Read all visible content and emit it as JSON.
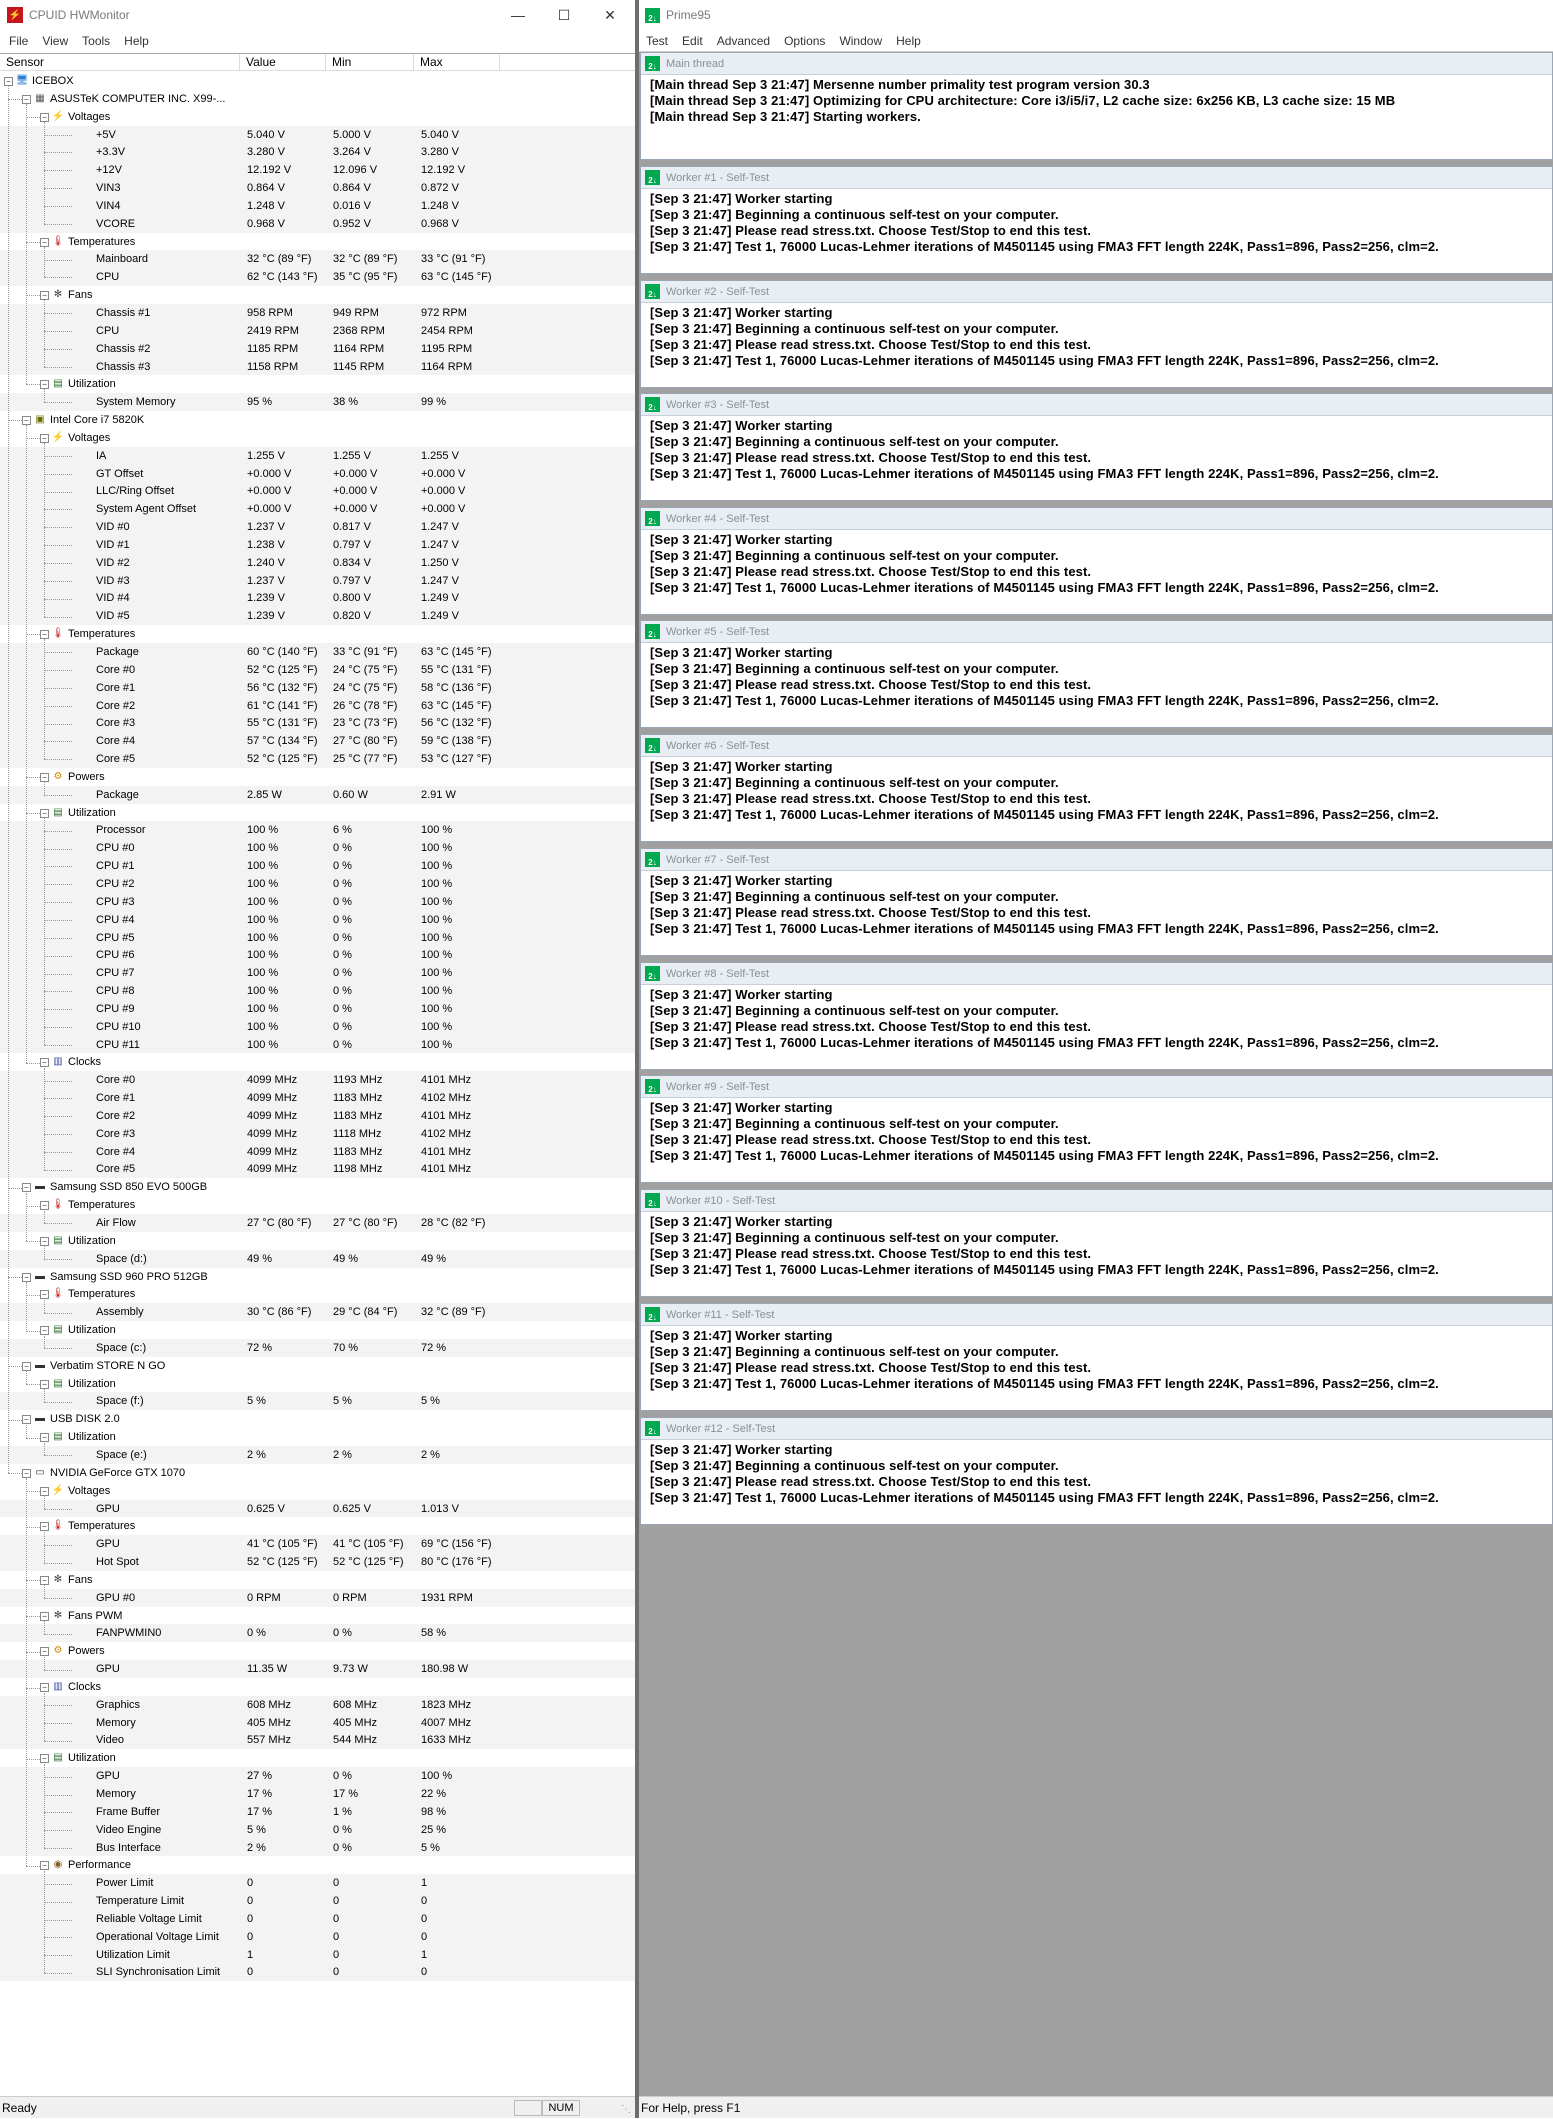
{
  "hwmonitor": {
    "title": "CPUID HWMonitor",
    "menu": [
      "File",
      "View",
      "Tools",
      "Help"
    ],
    "columns": [
      "Sensor",
      "Value",
      "Min",
      "Max"
    ],
    "status_text": "Ready",
    "status_num": "NUM",
    "rows": [
      {
        "level": 0,
        "icon": "computer",
        "label": "ICEBOX"
      },
      {
        "level": 1,
        "icon": "motherboard",
        "label": "ASUSTeK COMPUTER INC. X99-..."
      },
      {
        "level": 2,
        "icon": "voltage",
        "label": "Voltages"
      },
      {
        "level": 3,
        "label": "+5V",
        "v": "5.040 V",
        "mn": "5.000 V",
        "mx": "5.040 V"
      },
      {
        "level": 3,
        "label": "+3.3V",
        "v": "3.280 V",
        "mn": "3.264 V",
        "mx": "3.280 V"
      },
      {
        "level": 3,
        "label": "+12V",
        "v": "12.192 V",
        "mn": "12.096 V",
        "mx": "12.192 V"
      },
      {
        "level": 3,
        "label": "VIN3",
        "v": "0.864 V",
        "mn": "0.864 V",
        "mx": "0.872 V"
      },
      {
        "level": 3,
        "label": "VIN4",
        "v": "1.248 V",
        "mn": "0.016 V",
        "mx": "1.248 V"
      },
      {
        "level": 3,
        "label": "VCORE",
        "v": "0.968 V",
        "mn": "0.952 V",
        "mx": "0.968 V"
      },
      {
        "level": 2,
        "icon": "temperature",
        "label": "Temperatures"
      },
      {
        "level": 3,
        "label": "Mainboard",
        "v": "32 °C  (89 °F)",
        "mn": "32 °C  (89 °F)",
        "mx": "33 °C  (91 °F)"
      },
      {
        "level": 3,
        "label": "CPU",
        "v": "62 °C  (143 °F)",
        "mn": "35 °C  (95 °F)",
        "mx": "63 °C  (145 °F)"
      },
      {
        "level": 2,
        "icon": "fan",
        "label": "Fans"
      },
      {
        "level": 3,
        "label": "Chassis #1",
        "v": "958 RPM",
        "mn": "949 RPM",
        "mx": "972 RPM"
      },
      {
        "level": 3,
        "label": "CPU",
        "v": "2419 RPM",
        "mn": "2368 RPM",
        "mx": "2454 RPM"
      },
      {
        "level": 3,
        "label": "Chassis #2",
        "v": "1185 RPM",
        "mn": "1164 RPM",
        "mx": "1195 RPM"
      },
      {
        "level": 3,
        "label": "Chassis #3",
        "v": "1158 RPM",
        "mn": "1145 RPM",
        "mx": "1164 RPM"
      },
      {
        "level": 2,
        "icon": "utilization",
        "label": "Utilization"
      },
      {
        "level": 3,
        "label": "System Memory",
        "v": "95 %",
        "mn": "38 %",
        "mx": "99 %"
      },
      {
        "level": 1,
        "icon": "cpu",
        "label": "Intel Core i7 5820K"
      },
      {
        "level": 2,
        "icon": "voltage",
        "label": "Voltages"
      },
      {
        "level": 3,
        "label": "IA",
        "v": "1.255 V",
        "mn": "1.255 V",
        "mx": "1.255 V"
      },
      {
        "level": 3,
        "label": "GT Offset",
        "v": "+0.000 V",
        "mn": "+0.000 V",
        "mx": "+0.000 V"
      },
      {
        "level": 3,
        "label": "LLC/Ring Offset",
        "v": "+0.000 V",
        "mn": "+0.000 V",
        "mx": "+0.000 V"
      },
      {
        "level": 3,
        "label": "System Agent Offset",
        "v": "+0.000 V",
        "mn": "+0.000 V",
        "mx": "+0.000 V"
      },
      {
        "level": 3,
        "label": "VID #0",
        "v": "1.237 V",
        "mn": "0.817 V",
        "mx": "1.247 V"
      },
      {
        "level": 3,
        "label": "VID #1",
        "v": "1.238 V",
        "mn": "0.797 V",
        "mx": "1.247 V"
      },
      {
        "level": 3,
        "label": "VID #2",
        "v": "1.240 V",
        "mn": "0.834 V",
        "mx": "1.250 V"
      },
      {
        "level": 3,
        "label": "VID #3",
        "v": "1.237 V",
        "mn": "0.797 V",
        "mx": "1.247 V"
      },
      {
        "level": 3,
        "label": "VID #4",
        "v": "1.239 V",
        "mn": "0.800 V",
        "mx": "1.249 V"
      },
      {
        "level": 3,
        "label": "VID #5",
        "v": "1.239 V",
        "mn": "0.820 V",
        "mx": "1.249 V"
      },
      {
        "level": 2,
        "icon": "temperature",
        "label": "Temperatures"
      },
      {
        "level": 3,
        "label": "Package",
        "v": "60 °C  (140 °F)",
        "mn": "33 °C  (91 °F)",
        "mx": "63 °C  (145 °F)"
      },
      {
        "level": 3,
        "label": "Core #0",
        "v": "52 °C  (125 °F)",
        "mn": "24 °C  (75 °F)",
        "mx": "55 °C  (131 °F)"
      },
      {
        "level": 3,
        "label": "Core #1",
        "v": "56 °C  (132 °F)",
        "mn": "24 °C  (75 °F)",
        "mx": "58 °C  (136 °F)"
      },
      {
        "level": 3,
        "label": "Core #2",
        "v": "61 °C  (141 °F)",
        "mn": "26 °C  (78 °F)",
        "mx": "63 °C  (145 °F)"
      },
      {
        "level": 3,
        "label": "Core #3",
        "v": "55 °C  (131 °F)",
        "mn": "23 °C  (73 °F)",
        "mx": "56 °C  (132 °F)"
      },
      {
        "level": 3,
        "label": "Core #4",
        "v": "57 °C  (134 °F)",
        "mn": "27 °C  (80 °F)",
        "mx": "59 °C  (138 °F)"
      },
      {
        "level": 3,
        "label": "Core #5",
        "v": "52 °C  (125 °F)",
        "mn": "25 °C  (77 °F)",
        "mx": "53 °C  (127 °F)"
      },
      {
        "level": 2,
        "icon": "power",
        "label": "Powers"
      },
      {
        "level": 3,
        "label": "Package",
        "v": "2.85 W",
        "mn": "0.60 W",
        "mx": "2.91 W"
      },
      {
        "level": 2,
        "icon": "utilization",
        "label": "Utilization"
      },
      {
        "level": 3,
        "label": "Processor",
        "v": "100 %",
        "mn": "6 %",
        "mx": "100 %"
      },
      {
        "level": 3,
        "label": "CPU #0",
        "v": "100 %",
        "mn": "0 %",
        "mx": "100 %"
      },
      {
        "level": 3,
        "label": "CPU #1",
        "v": "100 %",
        "mn": "0 %",
        "mx": "100 %"
      },
      {
        "level": 3,
        "label": "CPU #2",
        "v": "100 %",
        "mn": "0 %",
        "mx": "100 %"
      },
      {
        "level": 3,
        "label": "CPU #3",
        "v": "100 %",
        "mn": "0 %",
        "mx": "100 %"
      },
      {
        "level": 3,
        "label": "CPU #4",
        "v": "100 %",
        "mn": "0 %",
        "mx": "100 %"
      },
      {
        "level": 3,
        "label": "CPU #5",
        "v": "100 %",
        "mn": "0 %",
        "mx": "100 %"
      },
      {
        "level": 3,
        "label": "CPU #6",
        "v": "100 %",
        "mn": "0 %",
        "mx": "100 %"
      },
      {
        "level": 3,
        "label": "CPU #7",
        "v": "100 %",
        "mn": "0 %",
        "mx": "100 %"
      },
      {
        "level": 3,
        "label": "CPU #8",
        "v": "100 %",
        "mn": "0 %",
        "mx": "100 %"
      },
      {
        "level": 3,
        "label": "CPU #9",
        "v": "100 %",
        "mn": "0 %",
        "mx": "100 %"
      },
      {
        "level": 3,
        "label": "CPU #10",
        "v": "100 %",
        "mn": "0 %",
        "mx": "100 %"
      },
      {
        "level": 3,
        "label": "CPU #11",
        "v": "100 %",
        "mn": "0 %",
        "mx": "100 %"
      },
      {
        "level": 2,
        "icon": "clock",
        "label": "Clocks"
      },
      {
        "level": 3,
        "label": "Core #0",
        "v": "4099 MHz",
        "mn": "1193 MHz",
        "mx": "4101 MHz"
      },
      {
        "level": 3,
        "label": "Core #1",
        "v": "4099 MHz",
        "mn": "1183 MHz",
        "mx": "4102 MHz"
      },
      {
        "level": 3,
        "label": "Core #2",
        "v": "4099 MHz",
        "mn": "1183 MHz",
        "mx": "4101 MHz"
      },
      {
        "level": 3,
        "label": "Core #3",
        "v": "4099 MHz",
        "mn": "1118 MHz",
        "mx": "4102 MHz"
      },
      {
        "level": 3,
        "label": "Core #4",
        "v": "4099 MHz",
        "mn": "1183 MHz",
        "mx": "4101 MHz"
      },
      {
        "level": 3,
        "label": "Core #5",
        "v": "4099 MHz",
        "mn": "1198 MHz",
        "mx": "4101 MHz"
      },
      {
        "level": 1,
        "icon": "drive",
        "label": "Samsung SSD 850 EVO 500GB"
      },
      {
        "level": 2,
        "icon": "temperature",
        "label": "Temperatures"
      },
      {
        "level": 3,
        "label": "Air Flow",
        "v": "27 °C  (80 °F)",
        "mn": "27 °C  (80 °F)",
        "mx": "28 °C  (82 °F)"
      },
      {
        "level": 2,
        "icon": "utilization",
        "label": "Utilization"
      },
      {
        "level": 3,
        "label": "Space (d:)",
        "v": "49 %",
        "mn": "49 %",
        "mx": "49 %"
      },
      {
        "level": 1,
        "icon": "drive",
        "label": "Samsung SSD 960 PRO 512GB"
      },
      {
        "level": 2,
        "icon": "temperature",
        "label": "Temperatures"
      },
      {
        "level": 3,
        "label": "Assembly",
        "v": "30 °C  (86 °F)",
        "mn": "29 °C  (84 °F)",
        "mx": "32 °C  (89 °F)"
      },
      {
        "level": 2,
        "icon": "utilization",
        "label": "Utilization"
      },
      {
        "level": 3,
        "label": "Space (c:)",
        "v": "72 %",
        "mn": "70 %",
        "mx": "72 %"
      },
      {
        "level": 1,
        "icon": "drive",
        "label": "Verbatim STORE N GO"
      },
      {
        "level": 2,
        "icon": "utilization",
        "label": "Utilization"
      },
      {
        "level": 3,
        "label": "Space (f:)",
        "v": "5 %",
        "mn": "5 %",
        "mx": "5 %"
      },
      {
        "level": 1,
        "icon": "drive",
        "label": "USB DISK 2.0"
      },
      {
        "level": 2,
        "icon": "utilization",
        "label": "Utilization"
      },
      {
        "level": 3,
        "label": "Space (e:)",
        "v": "2 %",
        "mn": "2 %",
        "mx": "2 %"
      },
      {
        "level": 1,
        "icon": "gpu",
        "label": "NVIDIA GeForce GTX 1070"
      },
      {
        "level": 2,
        "icon": "voltage",
        "label": "Voltages"
      },
      {
        "level": 3,
        "label": "GPU",
        "v": "0.625 V",
        "mn": "0.625 V",
        "mx": "1.013 V"
      },
      {
        "level": 2,
        "icon": "temperature",
        "label": "Temperatures"
      },
      {
        "level": 3,
        "label": "GPU",
        "v": "41 °C  (105 °F)",
        "mn": "41 °C  (105 °F)",
        "mx": "69 °C  (156 °F)"
      },
      {
        "level": 3,
        "label": "Hot Spot",
        "v": "52 °C  (125 °F)",
        "mn": "52 °C  (125 °F)",
        "mx": "80 °C  (176 °F)"
      },
      {
        "level": 2,
        "icon": "fan",
        "label": "Fans"
      },
      {
        "level": 3,
        "label": "GPU #0",
        "v": "0 RPM",
        "mn": "0 RPM",
        "mx": "1931 RPM"
      },
      {
        "level": 2,
        "icon": "fan",
        "label": "Fans PWM"
      },
      {
        "level": 3,
        "label": "FANPWMIN0",
        "v": "0 %",
        "mn": "0 %",
        "mx": "58 %"
      },
      {
        "level": 2,
        "icon": "power",
        "label": "Powers"
      },
      {
        "level": 3,
        "label": "GPU",
        "v": "11.35 W",
        "mn": "9.73 W",
        "mx": "180.98 W"
      },
      {
        "level": 2,
        "icon": "clock",
        "label": "Clocks"
      },
      {
        "level": 3,
        "label": "Graphics",
        "v": "608 MHz",
        "mn": "608 MHz",
        "mx": "1823 MHz"
      },
      {
        "level": 3,
        "label": "Memory",
        "v": "405 MHz",
        "mn": "405 MHz",
        "mx": "4007 MHz"
      },
      {
        "level": 3,
        "label": "Video",
        "v": "557 MHz",
        "mn": "544 MHz",
        "mx": "1633 MHz"
      },
      {
        "level": 2,
        "icon": "utilization",
        "label": "Utilization"
      },
      {
        "level": 3,
        "label": "GPU",
        "v": "27 %",
        "mn": "0 %",
        "mx": "100 %"
      },
      {
        "level": 3,
        "label": "Memory",
        "v": "17 %",
        "mn": "17 %",
        "mx": "22 %"
      },
      {
        "level": 3,
        "label": "Frame Buffer",
        "v": "17 %",
        "mn": "1 %",
        "mx": "98 %"
      },
      {
        "level": 3,
        "label": "Video Engine",
        "v": "5 %",
        "mn": "0 %",
        "mx": "25 %"
      },
      {
        "level": 3,
        "label": "Bus Interface",
        "v": "2 %",
        "mn": "0 %",
        "mx": "5 %"
      },
      {
        "level": 2,
        "icon": "performance",
        "label": "Performance"
      },
      {
        "level": 3,
        "label": "Power Limit",
        "v": "0",
        "mn": "0",
        "mx": "1"
      },
      {
        "level": 3,
        "label": "Temperature Limit",
        "v": "0",
        "mn": "0",
        "mx": "0"
      },
      {
        "level": 3,
        "label": "Reliable Voltage Limit",
        "v": "0",
        "mn": "0",
        "mx": "0"
      },
      {
        "level": 3,
        "label": "Operational Voltage Limit",
        "v": "0",
        "mn": "0",
        "mx": "0"
      },
      {
        "level": 3,
        "label": "Utilization Limit",
        "v": "1",
        "mn": "0",
        "mx": "1"
      },
      {
        "level": 3,
        "label": "SLI Synchronisation Limit",
        "v": "0",
        "mn": "0",
        "mx": "0"
      }
    ]
  },
  "prime95": {
    "title": "Prime95",
    "menu": [
      "Test",
      "Edit",
      "Advanced",
      "Options",
      "Window",
      "Help"
    ],
    "status_text": "For Help, press F1",
    "windows": [
      {
        "title": "Main thread",
        "lines": [
          "[Main thread Sep 3 21:47] Mersenne number primality test program version 30.3",
          "[Main thread Sep 3 21:47] Optimizing for CPU architecture: Core i3/i5/i7, L2 cache size: 6x256 KB, L3 cache size: 15 MB",
          "[Main thread Sep 3 21:47] Starting workers."
        ]
      },
      {
        "title": "Worker #1 - Self-Test",
        "lines": [
          "[Sep 3 21:47] Worker starting",
          "[Sep 3 21:47] Beginning a continuous self-test on your computer.",
          "[Sep 3 21:47] Please read stress.txt.  Choose Test/Stop to end this test.",
          "[Sep 3 21:47] Test 1, 76000 Lucas-Lehmer iterations of M4501145 using FMA3 FFT length 224K, Pass1=896, Pass2=256, clm=2."
        ]
      },
      {
        "title": "Worker #2 - Self-Test",
        "lines": [
          "[Sep 3 21:47] Worker starting",
          "[Sep 3 21:47] Beginning a continuous self-test on your computer.",
          "[Sep 3 21:47] Please read stress.txt.  Choose Test/Stop to end this test.",
          "[Sep 3 21:47] Test 1, 76000 Lucas-Lehmer iterations of M4501145 using FMA3 FFT length 224K, Pass1=896, Pass2=256, clm=2."
        ]
      },
      {
        "title": "Worker #3 - Self-Test",
        "lines": [
          "[Sep 3 21:47] Worker starting",
          "[Sep 3 21:47] Beginning a continuous self-test on your computer.",
          "[Sep 3 21:47] Please read stress.txt.  Choose Test/Stop to end this test.",
          "[Sep 3 21:47] Test 1, 76000 Lucas-Lehmer iterations of M4501145 using FMA3 FFT length 224K, Pass1=896, Pass2=256, clm=2."
        ]
      },
      {
        "title": "Worker #4 - Self-Test",
        "lines": [
          "[Sep 3 21:47] Worker starting",
          "[Sep 3 21:47] Beginning a continuous self-test on your computer.",
          "[Sep 3 21:47] Please read stress.txt.  Choose Test/Stop to end this test.",
          "[Sep 3 21:47] Test 1, 76000 Lucas-Lehmer iterations of M4501145 using FMA3 FFT length 224K, Pass1=896, Pass2=256, clm=2."
        ]
      },
      {
        "title": "Worker #5 - Self-Test",
        "lines": [
          "[Sep 3 21:47] Worker starting",
          "[Sep 3 21:47] Beginning a continuous self-test on your computer.",
          "[Sep 3 21:47] Please read stress.txt.  Choose Test/Stop to end this test.",
          "[Sep 3 21:47] Test 1, 76000 Lucas-Lehmer iterations of M4501145 using FMA3 FFT length 224K, Pass1=896, Pass2=256, clm=2."
        ]
      },
      {
        "title": "Worker #6 - Self-Test",
        "lines": [
          "[Sep 3 21:47] Worker starting",
          "[Sep 3 21:47] Beginning a continuous self-test on your computer.",
          "[Sep 3 21:47] Please read stress.txt.  Choose Test/Stop to end this test.",
          "[Sep 3 21:47] Test 1, 76000 Lucas-Lehmer iterations of M4501145 using FMA3 FFT length 224K, Pass1=896, Pass2=256, clm=2."
        ]
      },
      {
        "title": "Worker #7 - Self-Test",
        "lines": [
          "[Sep 3 21:47] Worker starting",
          "[Sep 3 21:47] Beginning a continuous self-test on your computer.",
          "[Sep 3 21:47] Please read stress.txt.  Choose Test/Stop to end this test.",
          "[Sep 3 21:47] Test 1, 76000 Lucas-Lehmer iterations of M4501145 using FMA3 FFT length 224K, Pass1=896, Pass2=256, clm=2."
        ]
      },
      {
        "title": "Worker #8 - Self-Test",
        "lines": [
          "[Sep 3 21:47] Worker starting",
          "[Sep 3 21:47] Beginning a continuous self-test on your computer.",
          "[Sep 3 21:47] Please read stress.txt.  Choose Test/Stop to end this test.",
          "[Sep 3 21:47] Test 1, 76000 Lucas-Lehmer iterations of M4501145 using FMA3 FFT length 224K, Pass1=896, Pass2=256, clm=2."
        ]
      },
      {
        "title": "Worker #9 - Self-Test",
        "lines": [
          "[Sep 3 21:47] Worker starting",
          "[Sep 3 21:47] Beginning a continuous self-test on your computer.",
          "[Sep 3 21:47] Please read stress.txt.  Choose Test/Stop to end this test.",
          "[Sep 3 21:47] Test 1, 76000 Lucas-Lehmer iterations of M4501145 using FMA3 FFT length 224K, Pass1=896, Pass2=256, clm=2."
        ]
      },
      {
        "title": "Worker #10 - Self-Test",
        "lines": [
          "[Sep 3 21:47] Worker starting",
          "[Sep 3 21:47] Beginning a continuous self-test on your computer.",
          "[Sep 3 21:47] Please read stress.txt.  Choose Test/Stop to end this test.",
          "[Sep 3 21:47] Test 1, 76000 Lucas-Lehmer iterations of M4501145 using FMA3 FFT length 224K, Pass1=896, Pass2=256, clm=2."
        ]
      },
      {
        "title": "Worker #11 - Self-Test",
        "lines": [
          "[Sep 3 21:47] Worker starting",
          "[Sep 3 21:47] Beginning a continuous self-test on your computer.",
          "[Sep 3 21:47] Please read stress.txt.  Choose Test/Stop to end this test.",
          "[Sep 3 21:47] Test 1, 76000 Lucas-Lehmer iterations of M4501145 using FMA3 FFT length 224K, Pass1=896, Pass2=256, clm=2."
        ]
      },
      {
        "title": "Worker #12 - Self-Test",
        "lines": [
          "[Sep 3 21:47] Worker starting",
          "[Sep 3 21:47] Beginning a continuous self-test on your computer.",
          "[Sep 3 21:47] Please read stress.txt.  Choose Test/Stop to end this test.",
          "[Sep 3 21:47] Test 1, 76000 Lucas-Lehmer iterations of M4501145 using FMA3 FFT length 224K, Pass1=896, Pass2=256, clm=2."
        ]
      }
    ]
  },
  "colors": {
    "hwm_icon": "#c4161c",
    "p95_icon": "#00a84f",
    "mdi_background": "#a0a0a0",
    "row_alt": "#f3f3f3"
  }
}
